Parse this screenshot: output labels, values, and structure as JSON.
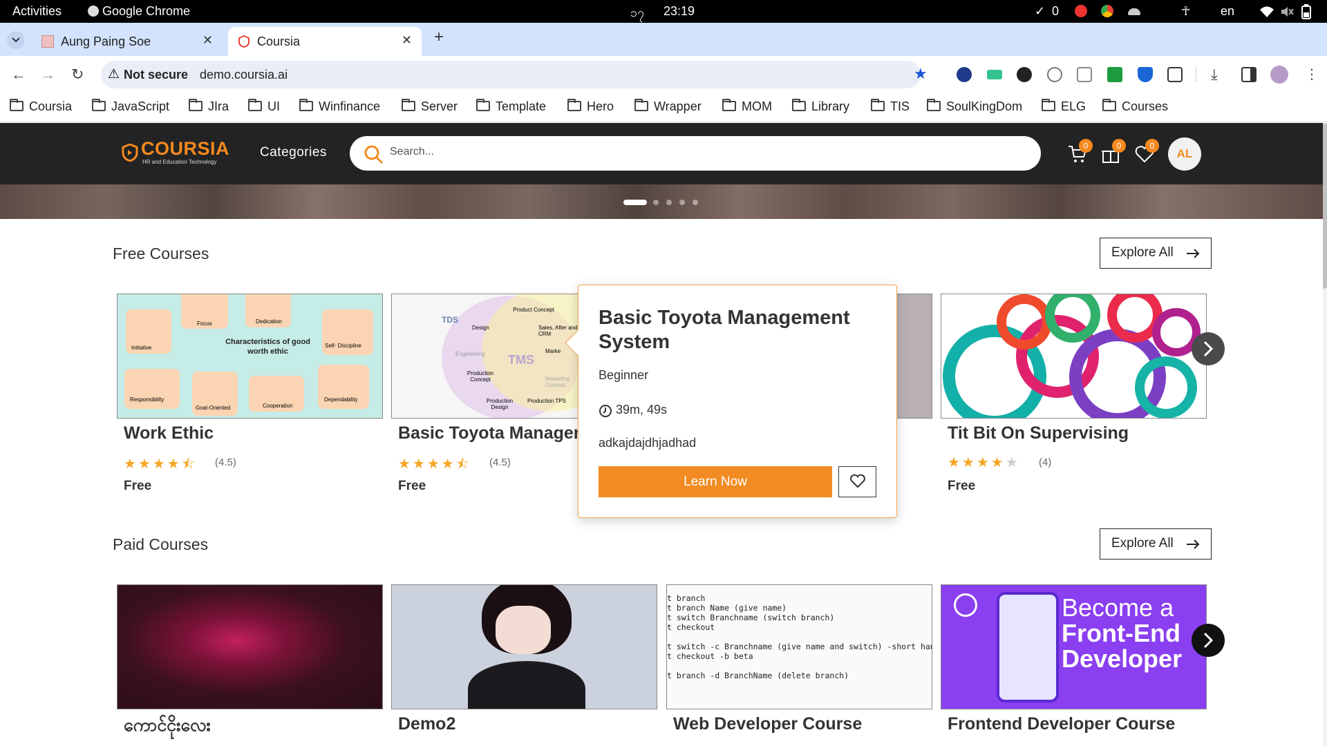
{
  "system_bar": {
    "activities": "Activities",
    "app": "Google Chrome",
    "clock_day": "၁၇",
    "clock_time": "23:19",
    "check_count": "0",
    "lang": "en"
  },
  "browser": {
    "tabs": [
      {
        "label": "Aung Paing Soe",
        "active": false
      },
      {
        "label": "Coursia",
        "active": true
      }
    ],
    "new_tab": "+",
    "security_label": "Not secure",
    "url": "demo.coursia.ai",
    "bookmarks": [
      "Coursia",
      "JavaScript",
      "JIra",
      "UI",
      "Winfinance",
      "Server",
      "Template",
      "Hero",
      "Wrapper",
      "MOM",
      "Library",
      "TIS",
      "SoulKingDom",
      "ELG",
      "Courses"
    ]
  },
  "site": {
    "logo_text": "COURSIA",
    "logo_tagline": "HR and Education Technology",
    "categories_label": "Categories",
    "search_placeholder": "Search...",
    "cart_count": "0",
    "gift_count": "0",
    "wishlist_count": "0",
    "avatar_initials": "AL",
    "accent_color": "#f28b22"
  },
  "free_section": {
    "title": "Free Courses",
    "explore_label": "Explore All",
    "cards": [
      {
        "title": "Work Ethic",
        "rating": "(4.5)",
        "rating_value": 4.5,
        "price": "Free",
        "image_title": "Characteristics of good worth ethic",
        "image_labels": [
          "Initiative",
          "Focus",
          "Dedication",
          "Self- Discipline",
          "Responsibility",
          "Goal-Oriented",
          "Cooperation",
          "Dependability"
        ]
      },
      {
        "title": "Basic Toyota Managem",
        "rating": "(4.5)",
        "rating_value": 4.5,
        "price": "Free",
        "image_labels": [
          "TDS",
          "TMS",
          "Design",
          "Engineering",
          "Production Concept",
          "Production Design",
          "Product Concept",
          "Sales, After and CRM",
          "Marke",
          "Marketing Concept",
          "Production TPS"
        ]
      },
      {
        "title": "Tit Bit On Supervising",
        "rating": "(4)",
        "rating_value": 4,
        "price": "Free"
      }
    ]
  },
  "popover": {
    "title": "Basic Toyota Management System",
    "level": "Beginner",
    "duration": "39m, 49s",
    "description": "adkajdajdhjadhad",
    "cta": "Learn Now"
  },
  "paid_section": {
    "title": "Paid Courses",
    "explore_label": "Explore All",
    "cards": [
      {
        "title": "ကောင်ငိုးလေး"
      },
      {
        "title": "Demo2"
      },
      {
        "title": "Web Developer Course",
        "code_lines": [
          "t branch",
          "t branch Name (give name)",
          "t switch Branchname (switch branch)",
          "t checkout",
          "",
          "t switch -c Branchname (give name and switch) -short han",
          "t checkout -b beta",
          "",
          "t branch -d BranchName (delete branch)"
        ]
      },
      {
        "title": "Frontend Developer Course",
        "image_text": [
          "Become a",
          "Front-End",
          "Developer"
        ]
      }
    ]
  }
}
